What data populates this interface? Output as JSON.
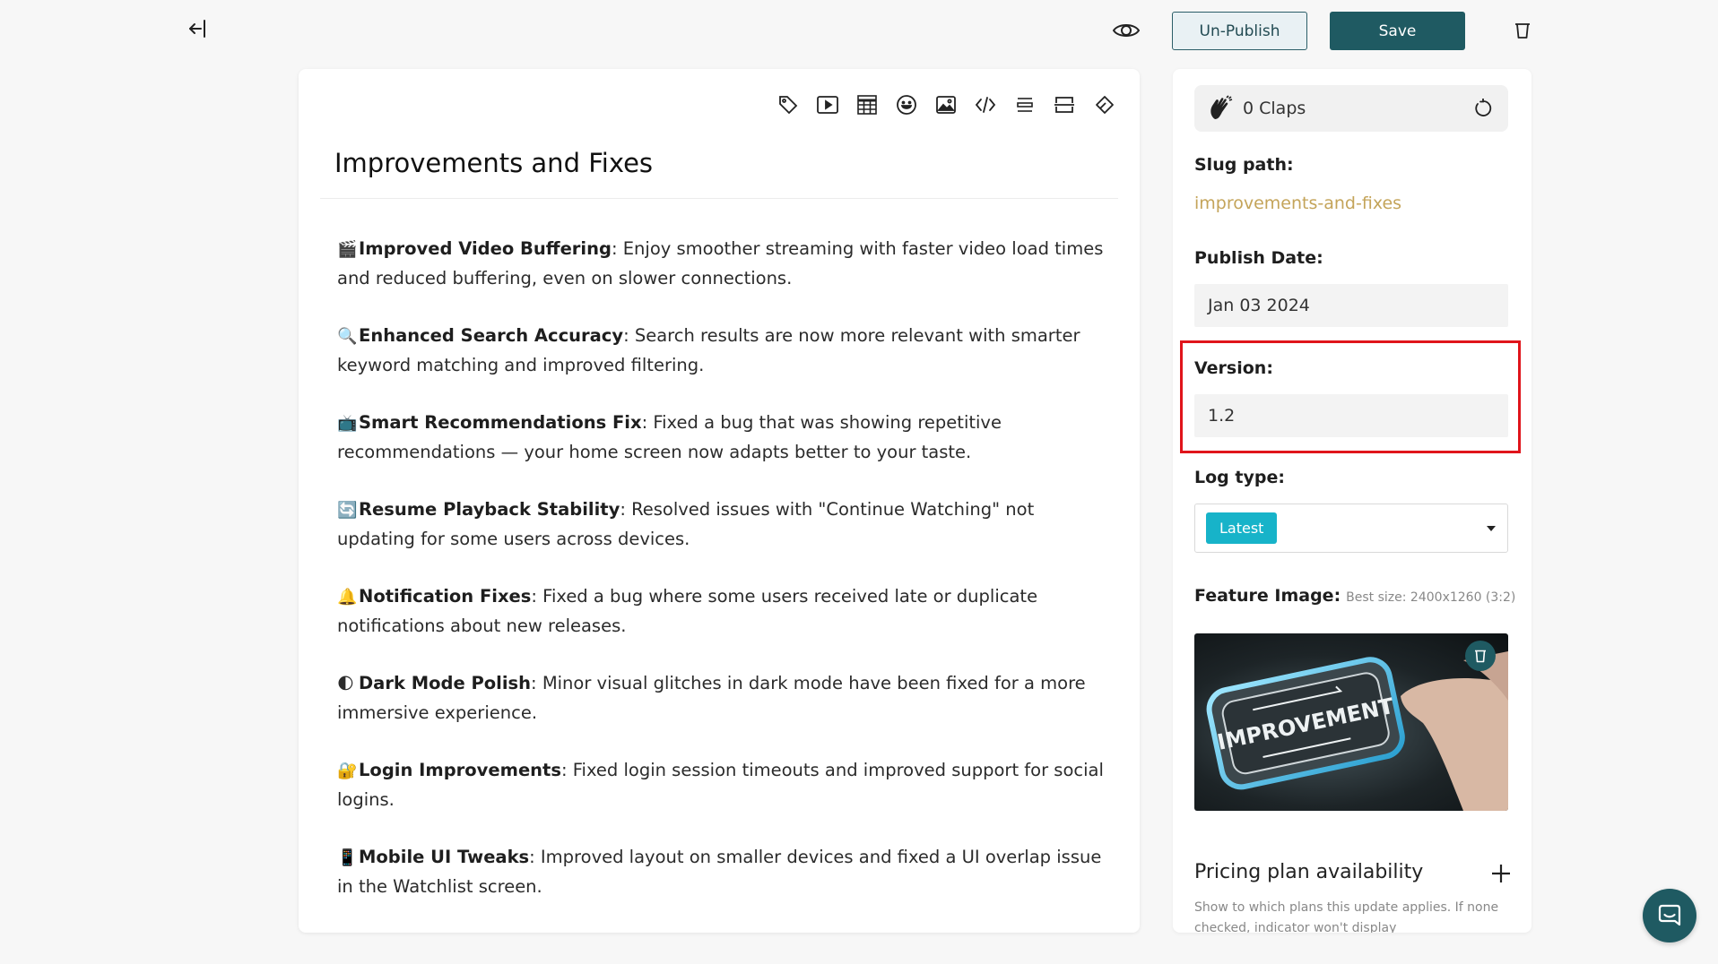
{
  "topbar": {
    "back_icon": "collapse-left-icon",
    "preview_icon": "eye-icon",
    "unpublish_label": "Un-Publish",
    "save_label": "Save",
    "delete_icon": "trash-icon"
  },
  "toolbar": {
    "tools": [
      "tag-icon",
      "video-icon",
      "table-icon",
      "emoji-icon",
      "image-icon",
      "code-icon",
      "divider-icon",
      "page-break-icon",
      "eraser-icon"
    ]
  },
  "editor": {
    "title": "Improvements and Fixes",
    "items": [
      {
        "emoji": "🎬",
        "heading": "Improved Video Buffering",
        "text": ": Enjoy smoother streaming with faster video load times and reduced buffering, even on slower connections."
      },
      {
        "emoji": "🔍",
        "heading": "Enhanced Search Accuracy",
        "text": ": Search results are now more relevant with smarter keyword matching and improved filtering."
      },
      {
        "emoji": "📺",
        "heading": "Smart Recommendations Fix",
        "text": ": Fixed a bug that was showing repetitive recommendations — your home screen now adapts better to your taste."
      },
      {
        "emoji": "🔄",
        "heading": "Resume Playback Stability",
        "text": ": Resolved issues with \"Continue Watching\" not updating for some users across devices."
      },
      {
        "emoji": "🔔",
        "heading": "Notification Fixes",
        "text": ": Fixed a bug where some users received late or duplicate notifications about new releases."
      },
      {
        "emoji": "🌓",
        "heading": "Dark Mode Polish",
        "text": ": Minor visual glitches in dark mode have been fixed for a more immersive experience."
      },
      {
        "emoji": "🔐",
        "heading": "Login Improvements",
        "text": ": Fixed login session timeouts and improved support for social logins."
      },
      {
        "emoji": "📱",
        "heading": "Mobile UI Tweaks",
        "text": ": Improved layout on smaller devices and fixed a UI overlap issue in the Watchlist screen."
      }
    ]
  },
  "side": {
    "claps_text": "0 Claps",
    "slug_label": "Slug path:",
    "slug_value": "improvements-and-fixes",
    "publish_label": "Publish Date:",
    "publish_value": "Jan 03 2024",
    "version_label": "Version:",
    "version_value": "1.2",
    "logtype_label": "Log type:",
    "logtype_value": "Latest",
    "feature_label": "Feature Image:",
    "feature_hint": "Best size: 2400x1260 (3:2)",
    "feature_image_text": "IMPROVEMENT",
    "pricing_title": "Pricing plan availability",
    "pricing_help": "Show to which plans this update applies. If none checked, indicator won't display"
  },
  "colors": {
    "accent": "#1f5a62",
    "slug": "#c4a45a",
    "chip": "#17b3c9",
    "highlight": "#e0141b"
  }
}
